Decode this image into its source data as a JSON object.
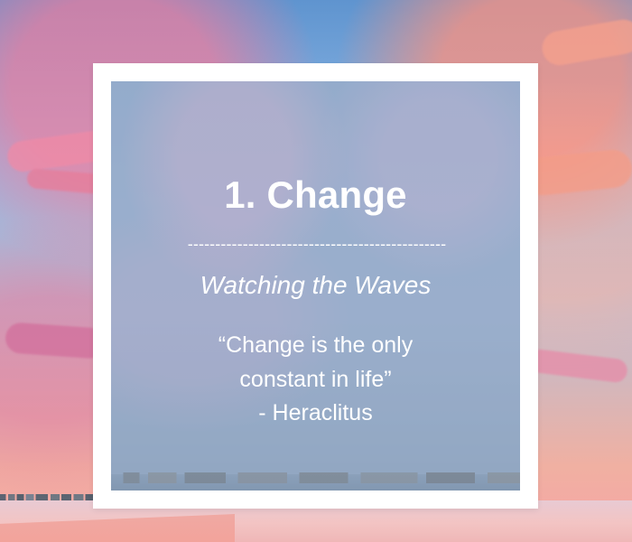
{
  "card": {
    "title": "1. Change",
    "divider": "-----------------------------------------------",
    "subtitle": "Watching the Waves",
    "quote_line_1": "“Change is the only",
    "quote_line_2": "constant in life”",
    "author": "- Heraclitus"
  },
  "colors": {
    "frame": "#ffffff",
    "text": "#ffffff"
  }
}
